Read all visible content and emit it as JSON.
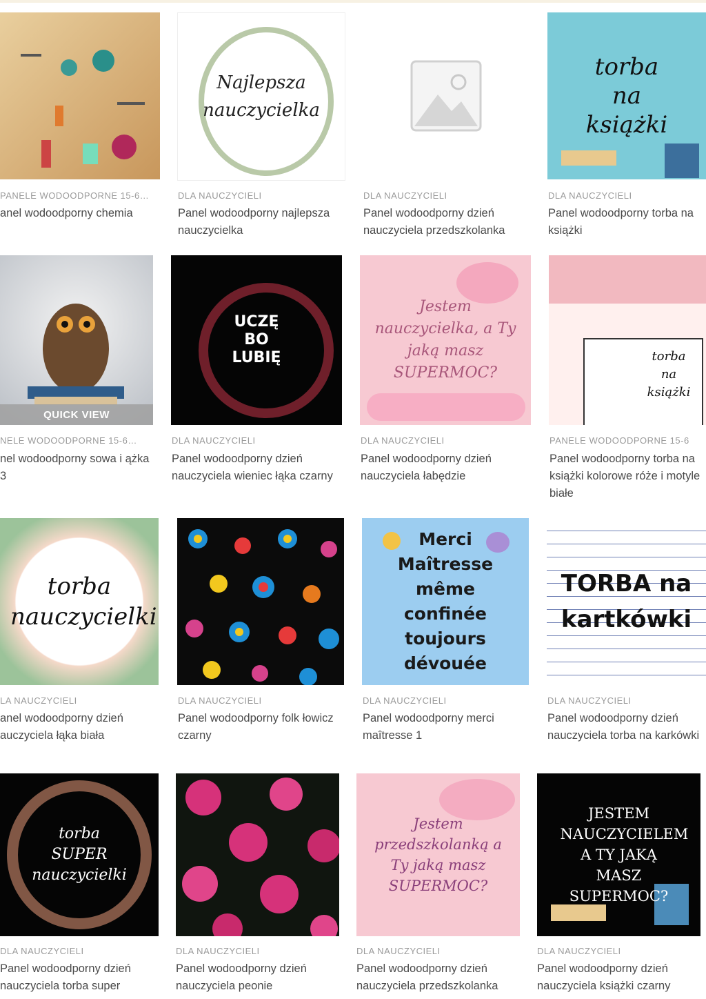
{
  "products": [
    {
      "category": "PANELE WODOODPORNE 15-6…",
      "title": "anel wodoodporny chemia",
      "image_text": "",
      "quick_view": ""
    },
    {
      "category": "DLA NAUCZYCIELI",
      "title": "Panel wodoodporny najlepsza nauczycielka",
      "image_text": "Najlepsza nauczycielka",
      "quick_view": ""
    },
    {
      "category": "DLA NAUCZYCIELI",
      "title": "Panel wodoodporny dzień nauczyciela przedszkolanka",
      "image_text": "",
      "quick_view": ""
    },
    {
      "category": "DLA NAUCZYCIELI",
      "title": "Panel wodoodporny torba na książki",
      "image_text": "torba na książki",
      "quick_view": ""
    },
    {
      "category": "NELE WODOODPORNE 15-6…",
      "title": "nel wodoodporny sowa i ążka 3",
      "image_text": "",
      "quick_view": "QUICK VIEW"
    },
    {
      "category": "DLA NAUCZYCIELI",
      "title": "Panel wodoodporny dzień nauczyciela wieniec łąka czarny",
      "image_text": "UCZĘ BO LUBIĘ",
      "quick_view": ""
    },
    {
      "category": "DLA NAUCZYCIELI",
      "title": "Panel wodoodporny dzień nauczyciela łabędzie",
      "image_text": "Jestem nauczycielka, a Ty jaką masz SUPERMOC?",
      "quick_view": ""
    },
    {
      "category": "PANELE WODOODPORNE 15-6",
      "title": "Panel wodoodporny torba na książki kolorowe róże i motyle białe",
      "image_text": "torba na książki",
      "quick_view": ""
    },
    {
      "category": "LA NAUCZYCIELI",
      "title": "anel wodoodporny dzień auczyciela łąka biała",
      "image_text": "torba nauczycielki",
      "quick_view": ""
    },
    {
      "category": "DLA NAUCZYCIELI",
      "title": "Panel wodoodporny folk łowicz czarny",
      "image_text": "",
      "quick_view": ""
    },
    {
      "category": "DLA NAUCZYCIELI",
      "title": "Panel wodoodporny merci maîtresse 1",
      "image_text": "Merci Maîtresse même confinée toujours dévouée",
      "quick_view": ""
    },
    {
      "category": "DLA NAUCZYCIELI",
      "title": "Panel wodoodporny dzień nauczyciela torba na karkówki",
      "image_text": "TORBA na kartkówki",
      "quick_view": ""
    },
    {
      "category": "DLA NAUCZYCIELI",
      "title": "Panel wodoodporny dzień nauczyciela torba super",
      "image_text": "torba SUPER nauczycielki",
      "quick_view": ""
    },
    {
      "category": "DLA NAUCZYCIELI",
      "title": "Panel wodoodporny dzień nauczyciela peonie",
      "image_text": "",
      "quick_view": ""
    },
    {
      "category": "DLA NAUCZYCIELI",
      "title": "Panel wodoodporny dzień nauczyciela przedszkolanka",
      "image_text": "Jestem przedszkolanką a Ty jaką masz SUPERMOC?",
      "quick_view": ""
    },
    {
      "category": "DLA NAUCZYCIELI",
      "title": "Panel wodoodporny dzień nauczyciela książki czarny",
      "image_text": "JESTEM NAUCZYCIELEM A TY JAKĄ MASZ SUPERMOC?",
      "quick_view": ""
    }
  ]
}
